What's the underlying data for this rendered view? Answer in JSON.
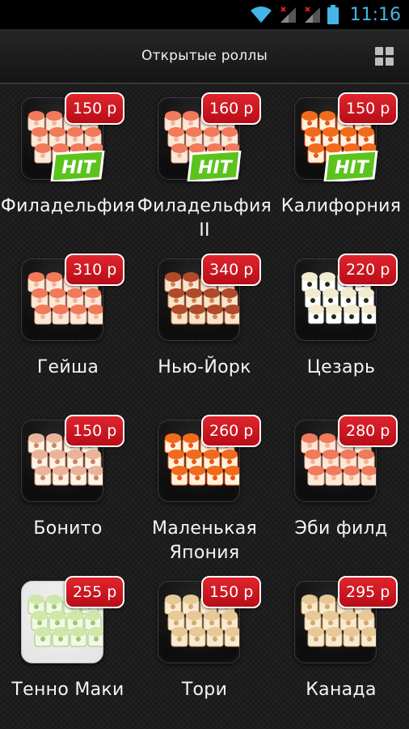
{
  "status_bar": {
    "time": "11:16",
    "icons": [
      "wifi-icon",
      "signal-icon",
      "signal-icon",
      "battery-icon"
    ],
    "accent": "#45b5e8"
  },
  "action_bar": {
    "title": "Открытые роллы",
    "grid_icon": "grid-view-icon"
  },
  "colors": {
    "price_badge": "#d41a24",
    "hit_badge": "#5cc31e",
    "background": "#191919"
  },
  "items": [
    {
      "name": "Филадельфия",
      "price": "150 р",
      "hit": "HIT",
      "image": "rolls-salmon-icon"
    },
    {
      "name": "Филадельфия II",
      "price": "160 р",
      "hit": "HIT",
      "image": "rolls-salmon-icon"
    },
    {
      "name": "Калифорния",
      "price": "150 р",
      "hit": "HIT",
      "image": "rolls-caviar-icon"
    },
    {
      "name": "Гейша",
      "price": "310 р",
      "image": "rolls-salmon-icon"
    },
    {
      "name": "Нью-Йорк",
      "price": "340 р",
      "image": "rolls-eel-icon"
    },
    {
      "name": "Цезарь",
      "price": "220 р",
      "image": "rolls-nori-icon"
    },
    {
      "name": "Бонито",
      "price": "150 р",
      "image": "rolls-bonito-icon"
    },
    {
      "name": "Маленькая Япония",
      "price": "260 р",
      "image": "rolls-caviar-icon"
    },
    {
      "name": "Эби филд",
      "price": "280 р",
      "image": "rolls-salmon-icon"
    },
    {
      "name": "Тенно Маки",
      "price": "255 р",
      "image": "rolls-cucumber-icon"
    },
    {
      "name": "Тори",
      "price": "150 р",
      "image": "rolls-sesame-icon"
    },
    {
      "name": "Канада",
      "price": "295 р",
      "image": "rolls-sesame-icon"
    }
  ]
}
